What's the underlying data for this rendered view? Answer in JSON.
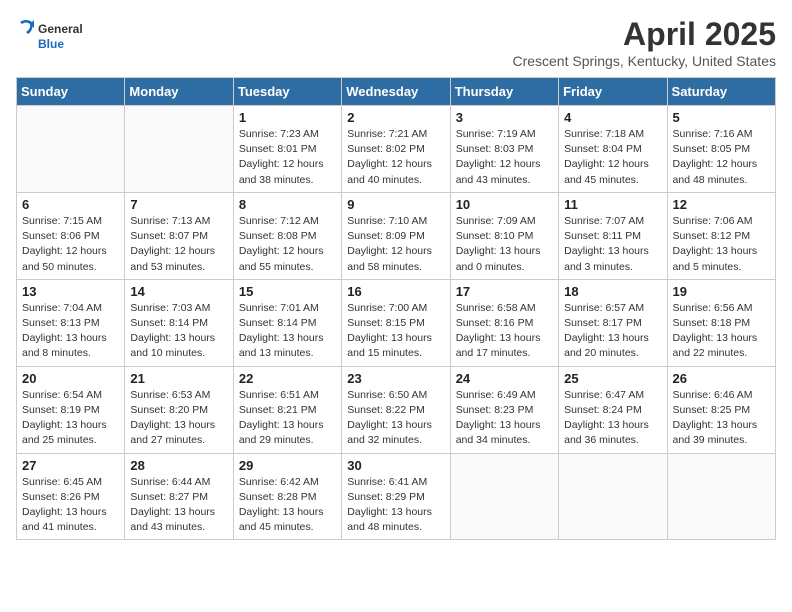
{
  "logo": {
    "general": "General",
    "blue": "Blue"
  },
  "header": {
    "title": "April 2025",
    "subtitle": "Crescent Springs, Kentucky, United States"
  },
  "weekdays": [
    "Sunday",
    "Monday",
    "Tuesday",
    "Wednesday",
    "Thursday",
    "Friday",
    "Saturday"
  ],
  "weeks": [
    [
      {
        "day": "",
        "info": ""
      },
      {
        "day": "",
        "info": ""
      },
      {
        "day": "1",
        "info": "Sunrise: 7:23 AM\nSunset: 8:01 PM\nDaylight: 12 hours and 38 minutes."
      },
      {
        "day": "2",
        "info": "Sunrise: 7:21 AM\nSunset: 8:02 PM\nDaylight: 12 hours and 40 minutes."
      },
      {
        "day": "3",
        "info": "Sunrise: 7:19 AM\nSunset: 8:03 PM\nDaylight: 12 hours and 43 minutes."
      },
      {
        "day": "4",
        "info": "Sunrise: 7:18 AM\nSunset: 8:04 PM\nDaylight: 12 hours and 45 minutes."
      },
      {
        "day": "5",
        "info": "Sunrise: 7:16 AM\nSunset: 8:05 PM\nDaylight: 12 hours and 48 minutes."
      }
    ],
    [
      {
        "day": "6",
        "info": "Sunrise: 7:15 AM\nSunset: 8:06 PM\nDaylight: 12 hours and 50 minutes."
      },
      {
        "day": "7",
        "info": "Sunrise: 7:13 AM\nSunset: 8:07 PM\nDaylight: 12 hours and 53 minutes."
      },
      {
        "day": "8",
        "info": "Sunrise: 7:12 AM\nSunset: 8:08 PM\nDaylight: 12 hours and 55 minutes."
      },
      {
        "day": "9",
        "info": "Sunrise: 7:10 AM\nSunset: 8:09 PM\nDaylight: 12 hours and 58 minutes."
      },
      {
        "day": "10",
        "info": "Sunrise: 7:09 AM\nSunset: 8:10 PM\nDaylight: 13 hours and 0 minutes."
      },
      {
        "day": "11",
        "info": "Sunrise: 7:07 AM\nSunset: 8:11 PM\nDaylight: 13 hours and 3 minutes."
      },
      {
        "day": "12",
        "info": "Sunrise: 7:06 AM\nSunset: 8:12 PM\nDaylight: 13 hours and 5 minutes."
      }
    ],
    [
      {
        "day": "13",
        "info": "Sunrise: 7:04 AM\nSunset: 8:13 PM\nDaylight: 13 hours and 8 minutes."
      },
      {
        "day": "14",
        "info": "Sunrise: 7:03 AM\nSunset: 8:14 PM\nDaylight: 13 hours and 10 minutes."
      },
      {
        "day": "15",
        "info": "Sunrise: 7:01 AM\nSunset: 8:14 PM\nDaylight: 13 hours and 13 minutes."
      },
      {
        "day": "16",
        "info": "Sunrise: 7:00 AM\nSunset: 8:15 PM\nDaylight: 13 hours and 15 minutes."
      },
      {
        "day": "17",
        "info": "Sunrise: 6:58 AM\nSunset: 8:16 PM\nDaylight: 13 hours and 17 minutes."
      },
      {
        "day": "18",
        "info": "Sunrise: 6:57 AM\nSunset: 8:17 PM\nDaylight: 13 hours and 20 minutes."
      },
      {
        "day": "19",
        "info": "Sunrise: 6:56 AM\nSunset: 8:18 PM\nDaylight: 13 hours and 22 minutes."
      }
    ],
    [
      {
        "day": "20",
        "info": "Sunrise: 6:54 AM\nSunset: 8:19 PM\nDaylight: 13 hours and 25 minutes."
      },
      {
        "day": "21",
        "info": "Sunrise: 6:53 AM\nSunset: 8:20 PM\nDaylight: 13 hours and 27 minutes."
      },
      {
        "day": "22",
        "info": "Sunrise: 6:51 AM\nSunset: 8:21 PM\nDaylight: 13 hours and 29 minutes."
      },
      {
        "day": "23",
        "info": "Sunrise: 6:50 AM\nSunset: 8:22 PM\nDaylight: 13 hours and 32 minutes."
      },
      {
        "day": "24",
        "info": "Sunrise: 6:49 AM\nSunset: 8:23 PM\nDaylight: 13 hours and 34 minutes."
      },
      {
        "day": "25",
        "info": "Sunrise: 6:47 AM\nSunset: 8:24 PM\nDaylight: 13 hours and 36 minutes."
      },
      {
        "day": "26",
        "info": "Sunrise: 6:46 AM\nSunset: 8:25 PM\nDaylight: 13 hours and 39 minutes."
      }
    ],
    [
      {
        "day": "27",
        "info": "Sunrise: 6:45 AM\nSunset: 8:26 PM\nDaylight: 13 hours and 41 minutes."
      },
      {
        "day": "28",
        "info": "Sunrise: 6:44 AM\nSunset: 8:27 PM\nDaylight: 13 hours and 43 minutes."
      },
      {
        "day": "29",
        "info": "Sunrise: 6:42 AM\nSunset: 8:28 PM\nDaylight: 13 hours and 45 minutes."
      },
      {
        "day": "30",
        "info": "Sunrise: 6:41 AM\nSunset: 8:29 PM\nDaylight: 13 hours and 48 minutes."
      },
      {
        "day": "",
        "info": ""
      },
      {
        "day": "",
        "info": ""
      },
      {
        "day": "",
        "info": ""
      }
    ]
  ]
}
